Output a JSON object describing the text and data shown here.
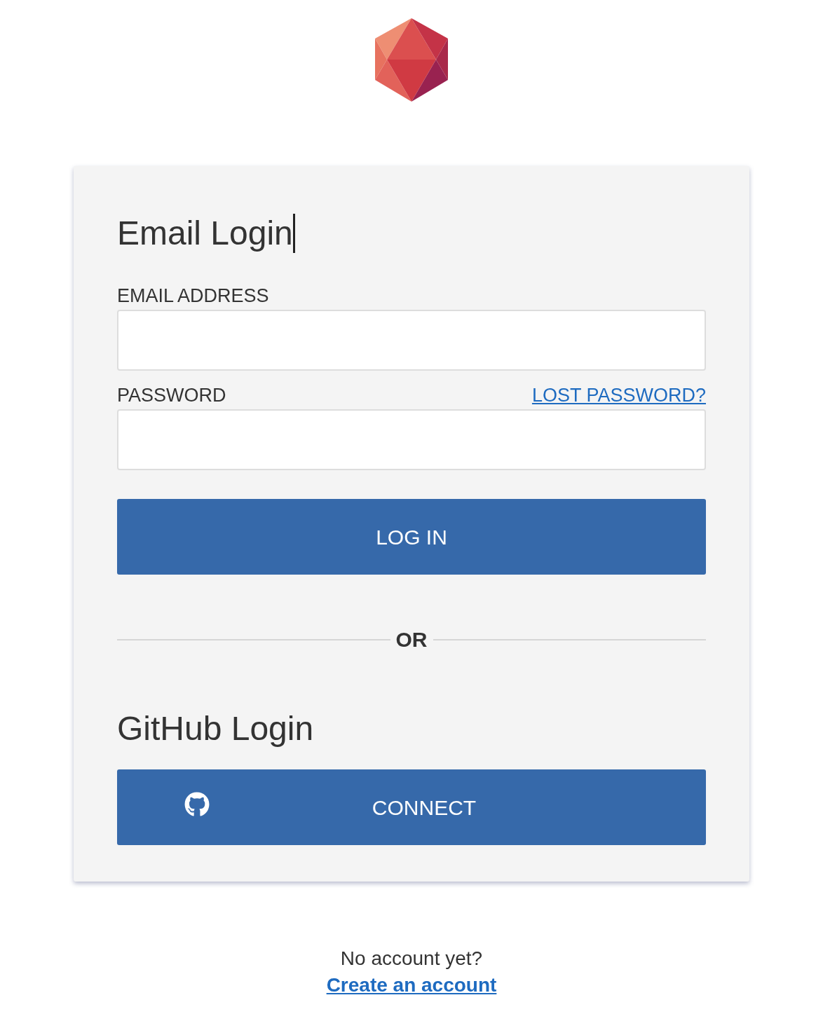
{
  "email_login": {
    "title": "Email Login",
    "email_label": "EMAIL ADDRESS",
    "password_label": "PASSWORD",
    "lost_password_link": "LOST PASSWORD?",
    "login_button": "LOG IN"
  },
  "divider": {
    "label": "OR"
  },
  "github_login": {
    "title": "GitHub Login",
    "connect_button": "CONNECT"
  },
  "footer": {
    "prompt": "No account yet?",
    "create_account_link": "Create an account"
  }
}
